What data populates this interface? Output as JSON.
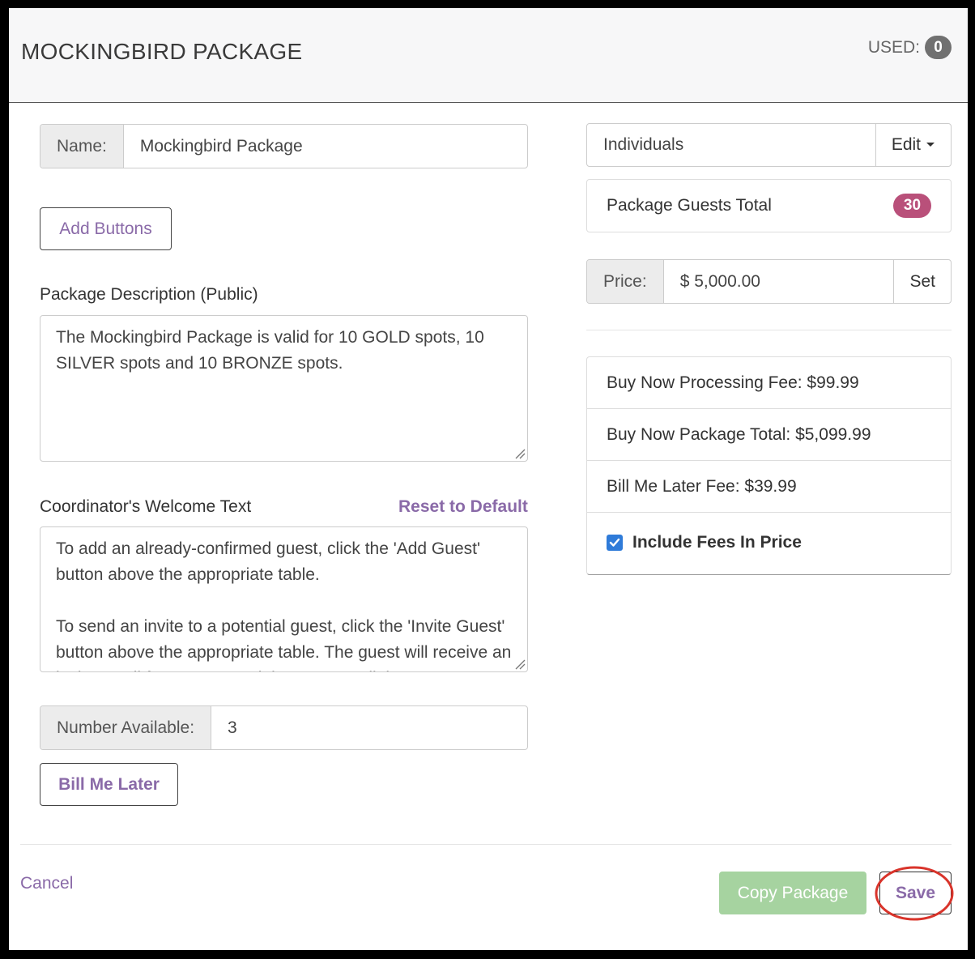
{
  "header": {
    "title": "MOCKINGBIRD PACKAGE",
    "used_label": "USED:",
    "used_count": "0"
  },
  "form": {
    "name_label": "Name:",
    "name_value": "Mockingbird Package",
    "add_buttons_label": "Add Buttons",
    "description_label": "Package Description (Public)",
    "description_value": "The Mockingbird Package is valid for 10 GOLD spots, 10 SILVER spots and 10 BRONZE spots.",
    "welcome_label": "Coordinator's Welcome Text",
    "reset_label": "Reset to Default",
    "welcome_paragraphs": [
      "To add an already-confirmed guest, click the 'Add Guest' button above the appropriate table.",
      "To send an invite to a potential guest, click the 'Invite Guest' button above the appropriate table. The guest will receive an invite email from you containing a secure link."
    ],
    "number_available_label": "Number Available:",
    "number_available_value": "3",
    "bill_me_later_label": "Bill Me Later"
  },
  "side": {
    "type_value": "Individuals",
    "edit_label": "Edit",
    "guests_total_label": "Package Guests Total",
    "guests_total_value": "30",
    "price_label": "Price:",
    "price_value": "$ 5,000.00",
    "set_label": "Set",
    "fees": [
      "Buy Now Processing Fee: $99.99",
      "Buy Now Package Total: $5,099.99",
      "Bill Me Later Fee: $39.99"
    ],
    "include_fees_label": "Include Fees In Price"
  },
  "footer": {
    "cancel_label": "Cancel",
    "copy_label": "Copy Package",
    "save_label": "Save"
  },
  "colors": {
    "accent_purple": "#8a6aa8",
    "badge_pink": "#b9507a",
    "copy_green": "#a6d3a0",
    "highlight_red": "#d9342b",
    "checkbox_blue": "#2f7bd9"
  }
}
